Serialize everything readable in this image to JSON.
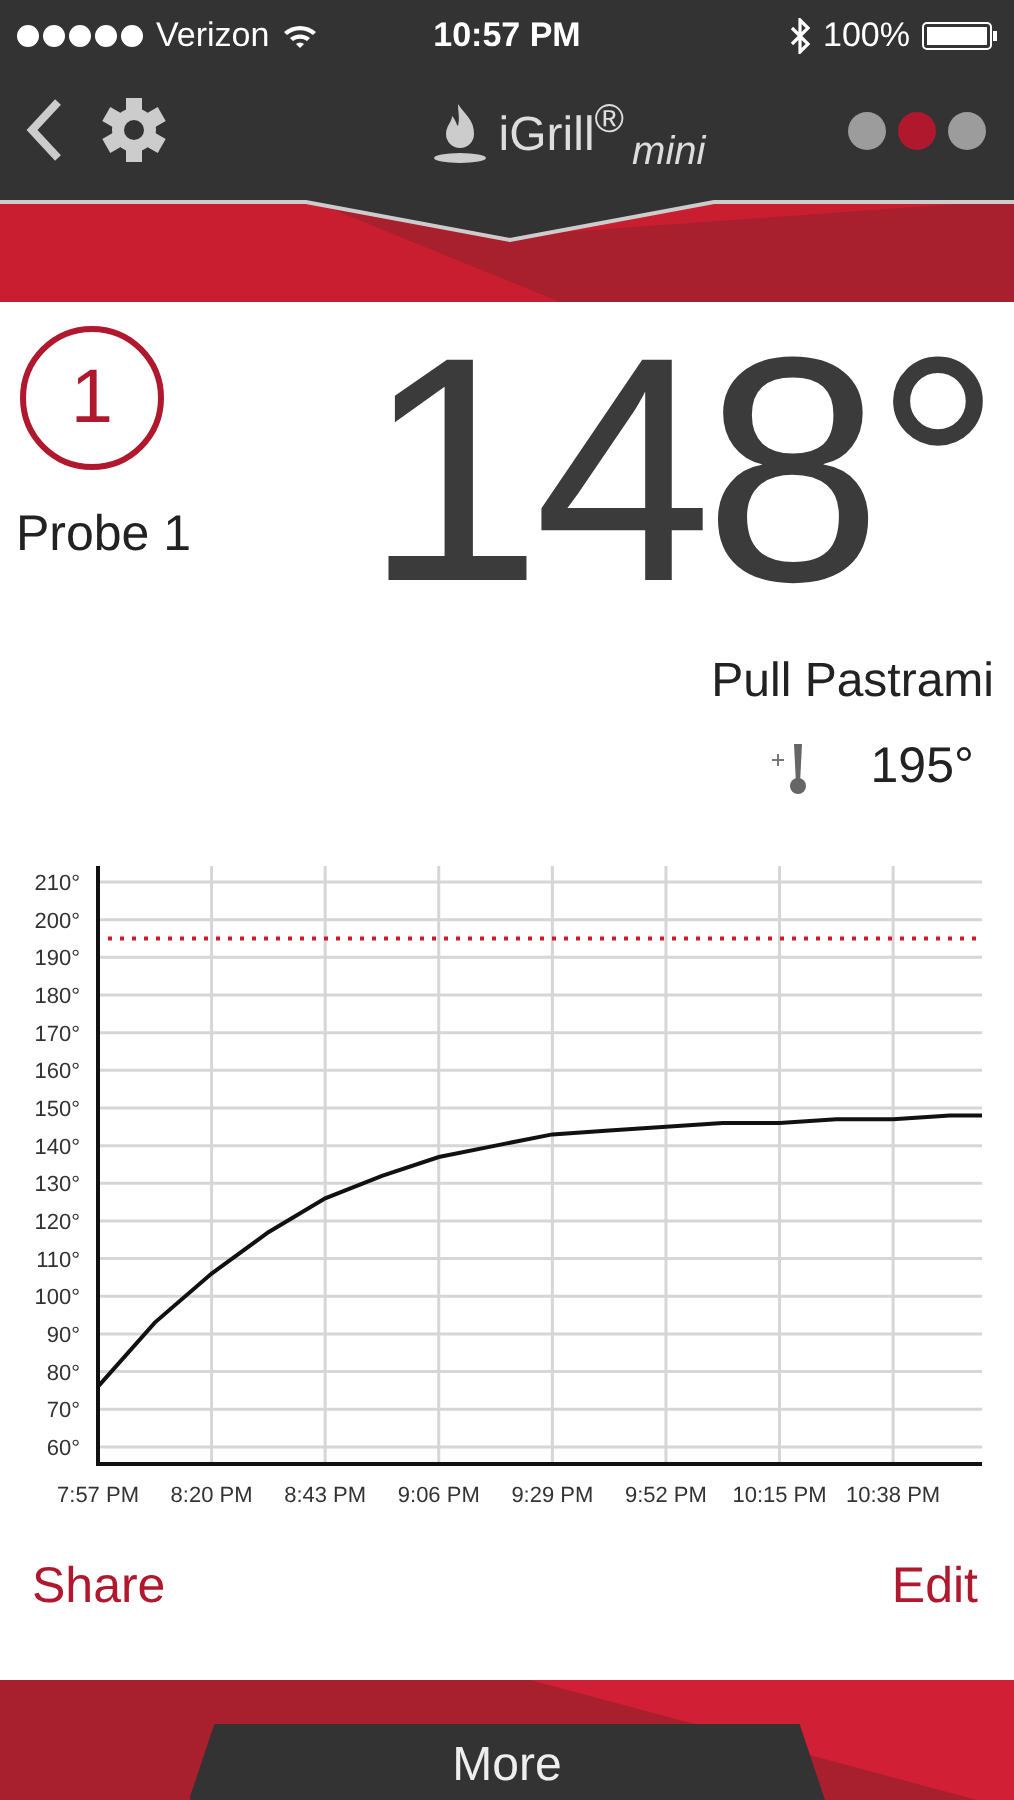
{
  "status_bar": {
    "carrier": "Verizon",
    "time": "10:57 PM",
    "battery": "100%"
  },
  "nav": {
    "logo": "iGrill$^{®}$",
    "logo_suffix": "mini",
    "page_dots": [
      {
        "selected": false
      },
      {
        "selected": true
      },
      {
        "selected": false
      }
    ]
  },
  "probe": {
    "number": "1",
    "name": "Probe 1",
    "temperature": "148°",
    "preset": "Pull Pastrami",
    "target": "195°"
  },
  "chart_data": {
    "type": "line",
    "x": [
      1197,
      1208.5,
      1220,
      1231.5,
      1243,
      1254.5,
      1266,
      1277.5,
      1289,
      1300.5,
      1312,
      1323.5,
      1335,
      1346.5,
      1358,
      1369.5,
      1376
    ],
    "values": [
      76,
      93,
      106,
      117,
      126,
      132,
      137,
      140,
      143,
      144,
      145,
      146,
      146,
      147,
      147,
      148,
      148
    ],
    "xticks": [
      {
        "value": 1197,
        "label": "7:57 PM"
      },
      {
        "value": 1220,
        "label": "8:20 PM"
      },
      {
        "value": 1243,
        "label": "8:43 PM"
      },
      {
        "value": 1266,
        "label": "9:06 PM"
      },
      {
        "value": 1289,
        "label": "9:29 PM"
      },
      {
        "value": 1312,
        "label": "9:52 PM"
      },
      {
        "value": 1335,
        "label": "10:15 PM"
      },
      {
        "value": 1358,
        "label": "10:38 PM"
      }
    ],
    "yticks": [
      {
        "value": 60,
        "label": "60°"
      },
      {
        "value": 70,
        "label": "70°"
      },
      {
        "value": 80,
        "label": "80°"
      },
      {
        "value": 90,
        "label": "90°"
      },
      {
        "value": 100,
        "label": "100°"
      },
      {
        "value": 110,
        "label": "110°"
      },
      {
        "value": 120,
        "label": "120°"
      },
      {
        "value": 130,
        "label": "130°"
      },
      {
        "value": 140,
        "label": "140°"
      },
      {
        "value": 150,
        "label": "150°"
      },
      {
        "value": 160,
        "label": "160°"
      },
      {
        "value": 170,
        "label": "170°"
      },
      {
        "value": 180,
        "label": "180°"
      },
      {
        "value": 190,
        "label": "190°"
      },
      {
        "value": 200,
        "label": "200°"
      },
      {
        "value": 210,
        "label": "210°"
      }
    ],
    "xlim": [
      1197,
      1376
    ],
    "ylim": [
      56,
      210
    ],
    "grid": true,
    "ref_lines": [
      {
        "axis": "y",
        "value": 195,
        "color": "#d0192f"
      }
    ]
  },
  "actions": [
    {
      "label": "Share"
    },
    {
      "label": "Edit"
    }
  ],
  "footer": {
    "label": "More"
  }
}
